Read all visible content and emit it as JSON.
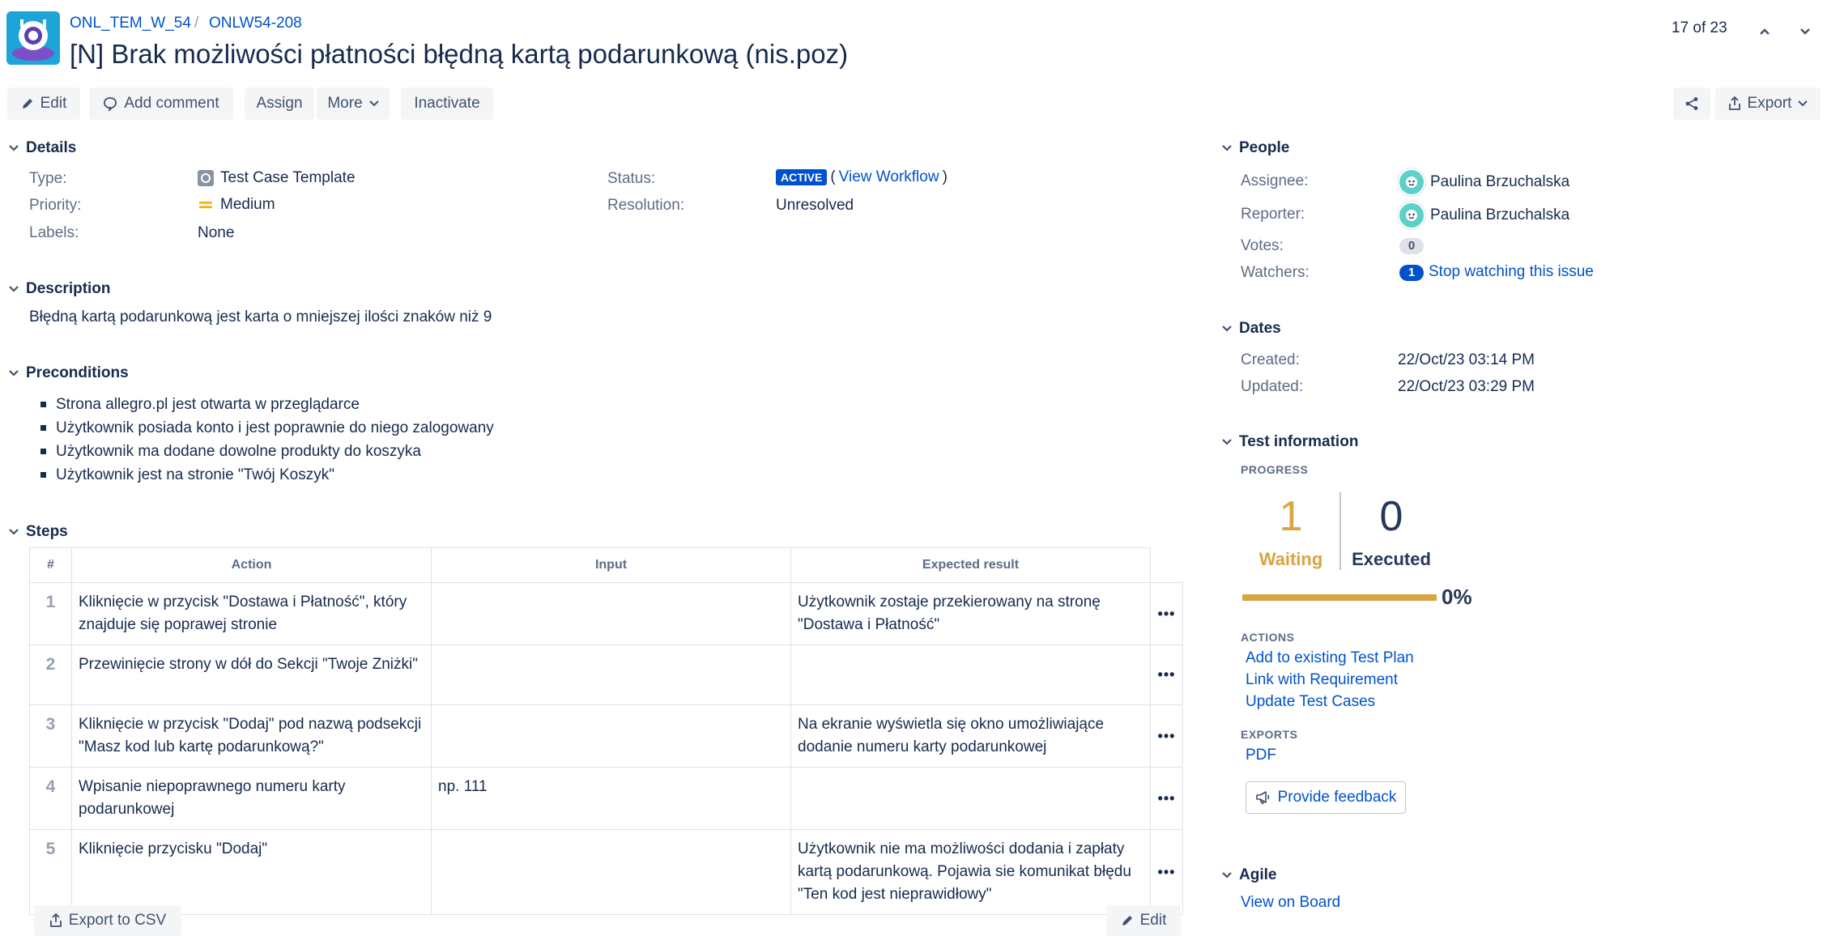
{
  "header": {
    "project_key": "ONL_TEM_W_54",
    "separator": "/",
    "issue_key": "ONLW54-208",
    "title": "[N] Brak możliwości płatności błędną kartą podarunkową (nis.poz)",
    "pager": "17 of 23"
  },
  "toolbar": {
    "edit": "Edit",
    "add_comment": "Add comment",
    "assign": "Assign",
    "more": "More",
    "inactivate": "Inactivate",
    "export": "Export"
  },
  "details": {
    "heading": "Details",
    "type_label": "Type:",
    "type_value": "Test Case Template",
    "priority_label": "Priority:",
    "priority_value": "Medium",
    "labels_label": "Labels:",
    "labels_value": "None",
    "status_label": "Status:",
    "status_value": "ACTIVE",
    "view_workflow": "View Workflow",
    "resolution_label": "Resolution:",
    "resolution_value": "Unresolved"
  },
  "description": {
    "heading": "Description",
    "text": "Błędną kartą podarunkową jest karta o mniejszej ilości znaków niż 9"
  },
  "preconditions": {
    "heading": "Preconditions",
    "items": [
      "Strona allegro.pl jest otwarta w przeglądarce",
      "Użytkownik posiada konto i jest poprawnie do niego zalogowany",
      "Użytkownik ma dodane dowolne produkty do koszyka",
      "Użytkownik jest na stronie \"Twój Koszyk\""
    ]
  },
  "steps": {
    "heading": "Steps",
    "columns": {
      "num": "#",
      "action": "Action",
      "input": "Input",
      "expected": "Expected result"
    },
    "rows": [
      {
        "num": "1",
        "action": "Kliknięcie w przycisk \"Dostawa i Płatność\", który znajduje się poprawej stronie",
        "input": "",
        "expected": "Użytkownik zostaje przekierowany na stronę \"Dostawa i Płatność\""
      },
      {
        "num": "2",
        "action": "Przewinięcie strony w dół do Sekcji \"Twoje Zniżki\"",
        "input": "",
        "expected": ""
      },
      {
        "num": "3",
        "action": "Kliknięcie w przycisk \"Dodaj\" pod nazwą podsekcji \"Masz kod lub kartę podarunkową?\"",
        "input": "",
        "expected": "Na ekranie wyświetla się okno umożliwiające dodanie numeru karty podarunkowej"
      },
      {
        "num": "4",
        "action": "Wpisanie niepoprawnego numeru karty podarunkowej",
        "input": "np. 111",
        "expected": ""
      },
      {
        "num": "5",
        "action": "Kliknięcie przycisku \"Dodaj\"",
        "input": "",
        "expected": "Użytkownik nie ma możliwości dodania i zapłaty kartą podarunkową. Pojawia sie komunikat błędu \"Ten kod jest nieprawidłowy\""
      }
    ],
    "row_menu": "•••",
    "export_csv": "Export to CSV",
    "edit": "Edit"
  },
  "people": {
    "heading": "People",
    "assignee_label": "Assignee:",
    "assignee": "Paulina Brzuchalska",
    "reporter_label": "Reporter:",
    "reporter": "Paulina Brzuchalska",
    "votes_label": "Votes:",
    "votes": "0",
    "watchers_label": "Watchers:",
    "watchers": "1",
    "stop_watching": "Stop watching this issue"
  },
  "dates": {
    "heading": "Dates",
    "created_label": "Created:",
    "created": "22/Oct/23 03:14 PM",
    "updated_label": "Updated:",
    "updated": "22/Oct/23 03:29 PM"
  },
  "test_info": {
    "heading": "Test information",
    "progress_label": "PROGRESS",
    "waiting_count": "1",
    "waiting_label": "Waiting",
    "executed_count": "0",
    "executed_label": "Executed",
    "waiting_fraction": 1.0,
    "percent": "0%",
    "actions_label": "ACTIONS",
    "actions": [
      "Add to existing Test Plan",
      "Link with Requirement",
      "Update Test Cases"
    ],
    "exports_label": "EXPORTS",
    "exports": [
      "PDF"
    ],
    "feedback": "Provide feedback"
  },
  "agile": {
    "heading": "Agile",
    "view_on_board": "View on Board"
  },
  "colors": {
    "link": "#0052cc",
    "waiting": "#d9a441",
    "executed": "#253858",
    "button_bg": "#f4f5f7"
  }
}
